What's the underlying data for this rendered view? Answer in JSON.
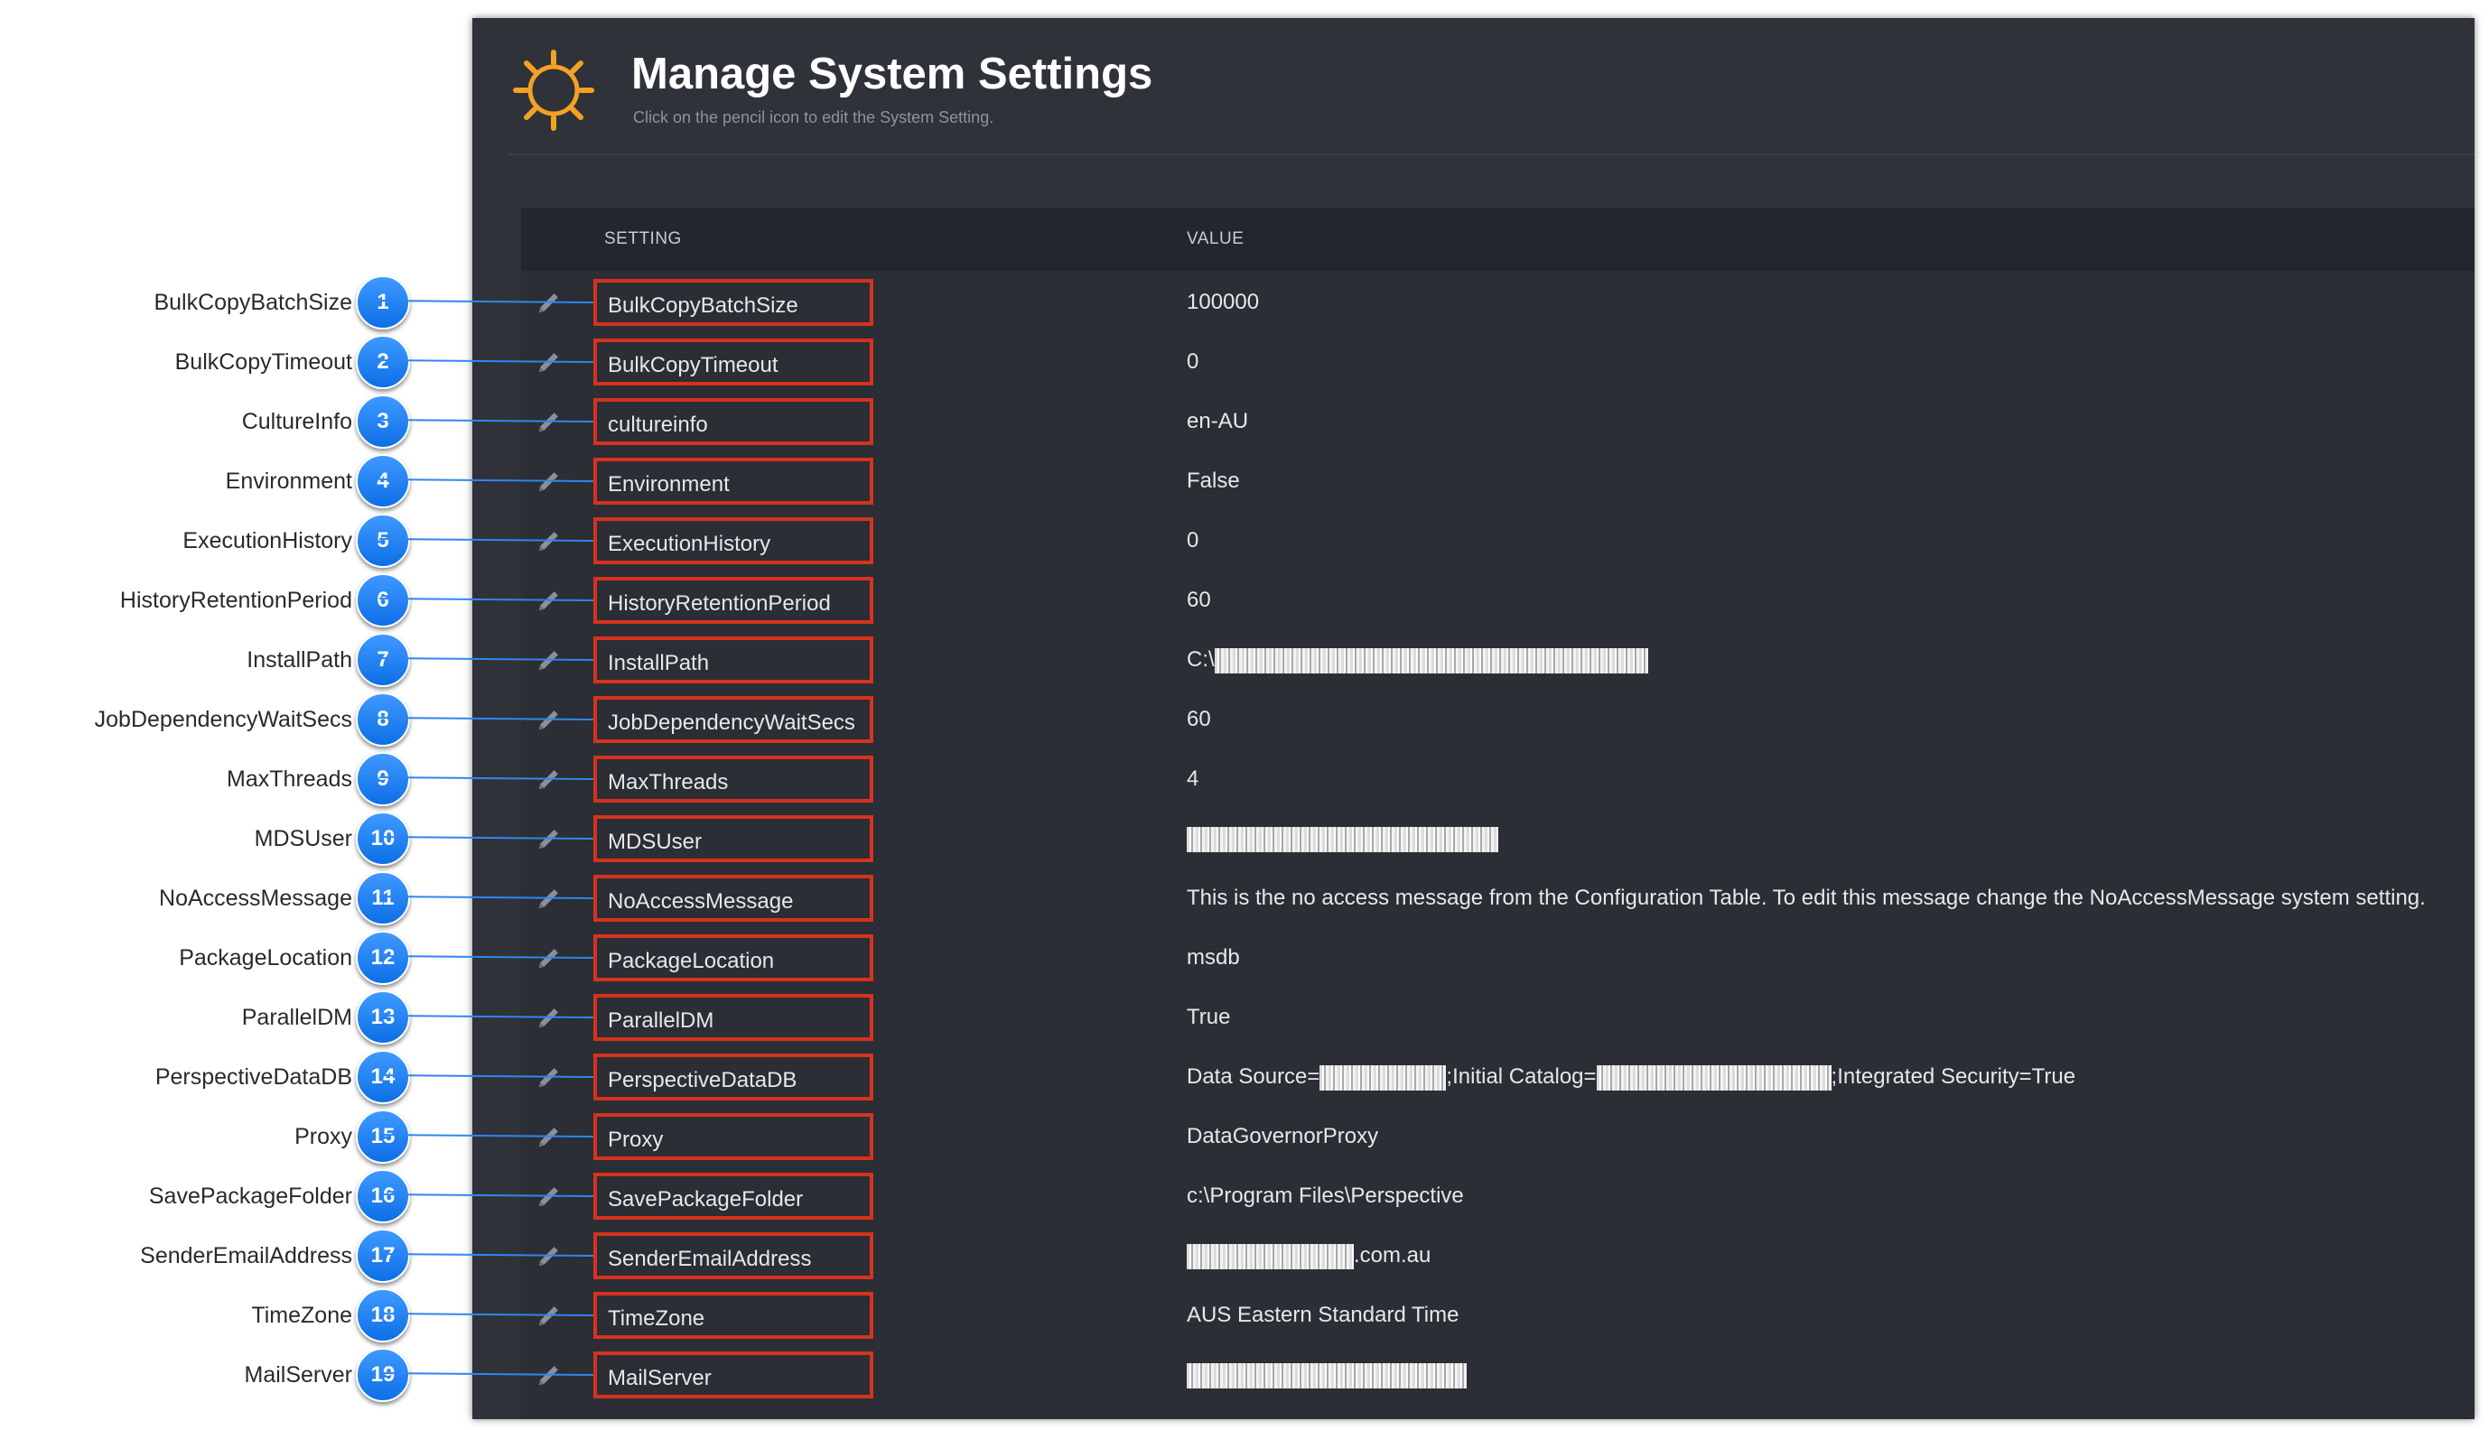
{
  "page": {
    "title": "Manage System Settings",
    "subtitle": "Click on the pencil icon to edit the System Setting.",
    "icon": "gear-icon"
  },
  "colors": {
    "accent": "#f4a124",
    "highlight_border": "#d6321e",
    "badge": "#1a7ff0",
    "panel_bg": "#2f3239"
  },
  "table": {
    "headers": {
      "setting": "SETTING",
      "value": "VALUE"
    },
    "rows": [
      {
        "number": "1",
        "label": "BulkCopyBatchSize",
        "setting": "BulkCopyBatchSize",
        "value": [
          "100000"
        ]
      },
      {
        "number": "2",
        "label": "BulkCopyTimeout",
        "setting": "BulkCopyTimeout",
        "value": [
          "0"
        ]
      },
      {
        "number": "3",
        "label": "CultureInfo",
        "setting": "cultureinfo",
        "value": [
          "en-AU"
        ]
      },
      {
        "number": "4",
        "label": "Environment",
        "setting": "Environment",
        "value": [
          "False"
        ]
      },
      {
        "number": "5",
        "label": "ExecutionHistory",
        "setting": "ExecutionHistory",
        "value": [
          "0"
        ]
      },
      {
        "number": "6",
        "label": "HistoryRetentionPeriod",
        "setting": "HistoryRetentionPeriod",
        "value": [
          "60"
        ]
      },
      {
        "number": "7",
        "label": "InstallPath",
        "setting": "InstallPath",
        "value": [
          "C:\\",
          "#redacted"
        ]
      },
      {
        "number": "8",
        "label": "JobDependencyWaitSecs",
        "setting": "JobDependencyWaitSecs",
        "value": [
          "60"
        ]
      },
      {
        "number": "9",
        "label": "MaxThreads",
        "setting": "MaxThreads",
        "value": [
          "4"
        ]
      },
      {
        "number": "10",
        "label": "MDSUser",
        "setting": "MDSUser",
        "value": [
          "#redacted"
        ]
      },
      {
        "number": "11",
        "label": "NoAccessMessage",
        "setting": "NoAccessMessage",
        "value": [
          "This is the no access message from the Configuration Table. To edit this message change the NoAccessMessage system setting."
        ]
      },
      {
        "number": "12",
        "label": "PackageLocation",
        "setting": "PackageLocation",
        "value": [
          "msdb"
        ]
      },
      {
        "number": "13",
        "label": "ParallelDM",
        "setting": "ParallelDM",
        "value": [
          "True"
        ]
      },
      {
        "number": "14",
        "label": "PerspectiveDataDB",
        "setting": "PerspectiveDataDB",
        "value": [
          "Data Source=",
          "#redacted",
          ";Initial Catalog=",
          "#redacted",
          ";Integrated Security=True"
        ]
      },
      {
        "number": "15",
        "label": "Proxy",
        "setting": "Proxy",
        "value": [
          "DataGovernorProxy"
        ]
      },
      {
        "number": "16",
        "label": "SavePackageFolder",
        "setting": "SavePackageFolder",
        "value": [
          "c:\\Program Files\\Perspective"
        ]
      },
      {
        "number": "17",
        "label": "SenderEmailAddress",
        "setting": "SenderEmailAddress",
        "value": [
          "#redacted",
          ".com.au"
        ]
      },
      {
        "number": "18",
        "label": "TimeZone",
        "setting": "TimeZone",
        "value": [
          "AUS Eastern Standard Time"
        ]
      },
      {
        "number": "19",
        "label": "MailServer",
        "setting": "MailServer",
        "value": [
          "#redacted"
        ]
      }
    ]
  }
}
